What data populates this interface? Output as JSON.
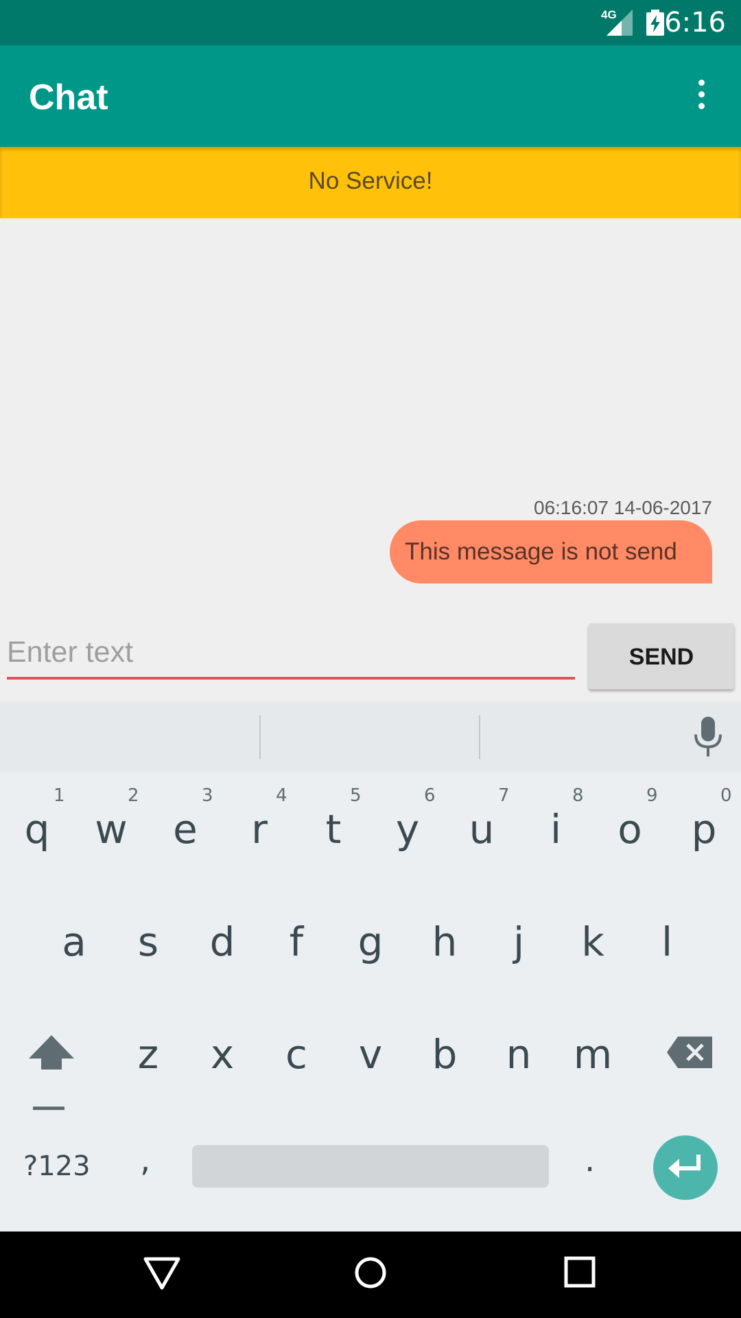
{
  "status_bar": {
    "time": "6:16",
    "network_label": "4G",
    "icons": [
      "signal-icon",
      "battery-charging-icon"
    ]
  },
  "app_bar": {
    "title": "Chat",
    "menu_icon": "overflow-menu-icon"
  },
  "banner": {
    "text": "No Service!"
  },
  "messages": [
    {
      "timestamp": "06:16:07 14-06-2017",
      "text": "This message is  not send"
    }
  ],
  "composer": {
    "placeholder": "Enter text",
    "send_label": "SEND"
  },
  "keyboard": {
    "row1": [
      {
        "letter": "q",
        "num": "1"
      },
      {
        "letter": "w",
        "num": "2"
      },
      {
        "letter": "e",
        "num": "3"
      },
      {
        "letter": "r",
        "num": "4"
      },
      {
        "letter": "t",
        "num": "5"
      },
      {
        "letter": "y",
        "num": "6"
      },
      {
        "letter": "u",
        "num": "7"
      },
      {
        "letter": "i",
        "num": "8"
      },
      {
        "letter": "o",
        "num": "9"
      },
      {
        "letter": "p",
        "num": "0"
      }
    ],
    "row2": [
      "a",
      "s",
      "d",
      "f",
      "g",
      "h",
      "j",
      "k",
      "l"
    ],
    "row3": [
      "z",
      "x",
      "c",
      "v",
      "b",
      "n",
      "m"
    ],
    "symbols_label": "?123",
    "comma": ",",
    "period": ".",
    "icons": [
      "shift-icon",
      "backspace-icon",
      "microphone-icon",
      "enter-icon"
    ]
  },
  "nav_bar": {
    "icons": [
      "back-icon",
      "home-icon",
      "recents-icon"
    ]
  },
  "colors": {
    "status_bar": "#00796b",
    "app_bar": "#009688",
    "banner": "#ffc10a",
    "bubble": "#ff8a65",
    "input_underline": "#e84f5d",
    "enter_key": "#4db6ac"
  }
}
